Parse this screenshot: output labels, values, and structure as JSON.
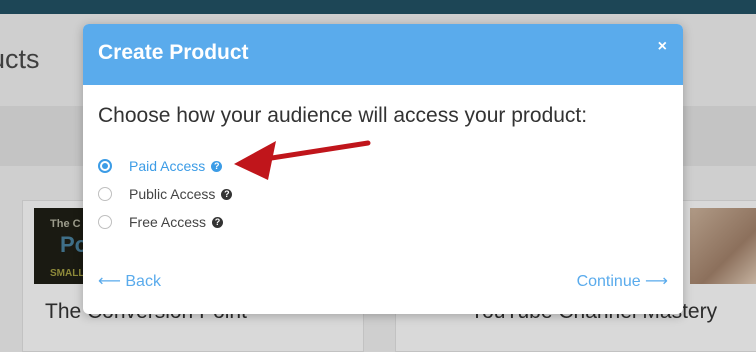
{
  "background": {
    "heading": "ucts",
    "card_left_title": "The Conversion Point",
    "card_right_title": "YouTube Channel Mastery",
    "thumb_left_lines": [
      "The C",
      "Po",
      "SMALL"
    ]
  },
  "modal": {
    "title": "Create Product",
    "close_label": "×",
    "prompt": "Choose how your audience will access your product:",
    "options": [
      {
        "label": "Paid Access",
        "selected": true
      },
      {
        "label": "Public Access",
        "selected": false
      },
      {
        "label": "Free Access",
        "selected": false
      }
    ],
    "help_glyph": "?",
    "back_label": "⟵ Back",
    "continue_label": "Continue ⟶"
  },
  "colors": {
    "header": "#5aabec",
    "accent": "#3c9ce6",
    "annotation_arrow": "#c0151b"
  }
}
